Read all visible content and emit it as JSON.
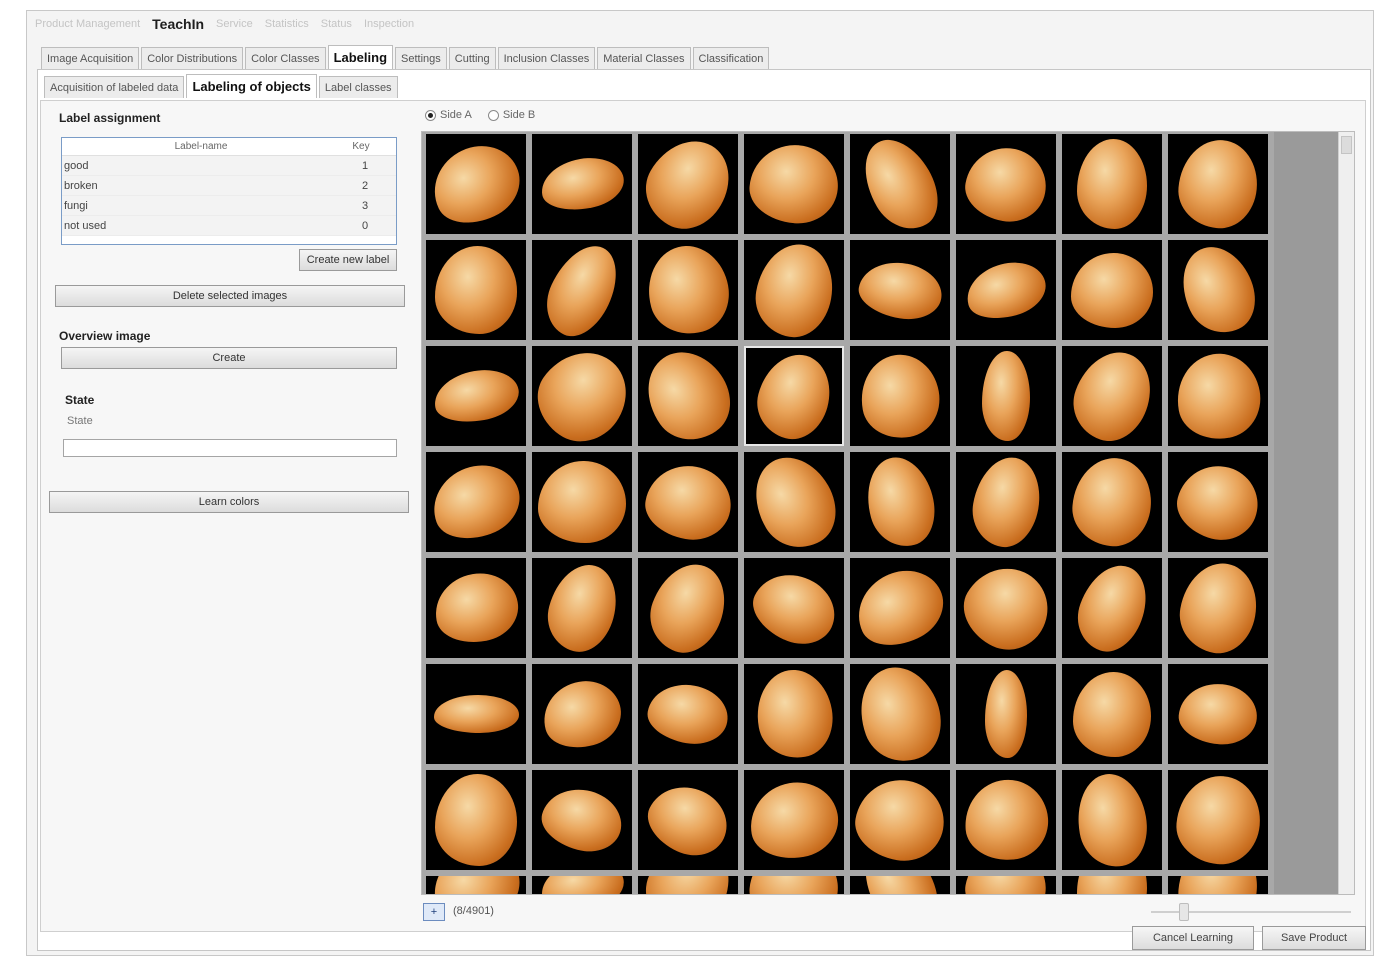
{
  "menu": [
    "Product Management",
    "TeachIn",
    "Service",
    "Statistics",
    "Status",
    "Inspection"
  ],
  "active_menu_index": 1,
  "tabs_level1": [
    "Image Acquisition",
    "Color Distributions",
    "Color Classes",
    "Labeling",
    "Settings",
    "Cutting",
    "Inclusion Classes",
    "Material Classes",
    "Classification"
  ],
  "active_tab_level1_index": 3,
  "tabs_level2": [
    "Acquisition of labeled data",
    "Labeling of objects",
    "Label classes"
  ],
  "active_tab_level2_index": 1,
  "label_assignment": {
    "title": "Label assignment",
    "col_name": "Label-name",
    "col_key": "Key",
    "rows": [
      {
        "name": "good",
        "key": "1"
      },
      {
        "name": "broken",
        "key": "2"
      },
      {
        "name": "fungi",
        "key": "3"
      },
      {
        "name": "not used",
        "key": "0"
      }
    ],
    "create_button": "Create new label",
    "delete_button": "Delete selected images"
  },
  "overview": {
    "title": "Overview image",
    "create_button": "Create"
  },
  "state": {
    "title": "State",
    "label": "State",
    "value": ""
  },
  "learn_button": "Learn colors",
  "sides": {
    "side_a": "Side A",
    "side_b": "Side B",
    "selected": "side_a"
  },
  "count_text": "(8/4901)",
  "small_button": "+",
  "footer": {
    "cancel": "Cancel Learning",
    "save": "Save Product"
  },
  "colors": {
    "accent_border": "#7a9cc7",
    "kernel_light": "#f6d9a6",
    "kernel_mid": "#e9a45a",
    "kernel_dark": "#c96d1e",
    "grid_background": "#a8a8a8"
  }
}
